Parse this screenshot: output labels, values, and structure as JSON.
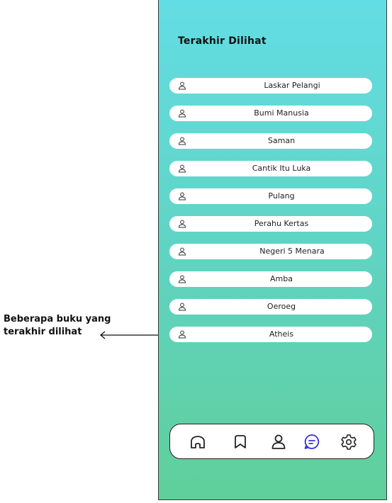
{
  "annotation": {
    "line1": "Beberapa buku yang",
    "line2": "terakhir dilihat"
  },
  "screen": {
    "title": "Terakhir Dilihat"
  },
  "recent_items": [
    {
      "label": "Laskar Pelangi",
      "icon": "user-icon"
    },
    {
      "label": "Bumi Manusia",
      "icon": "user-icon"
    },
    {
      "label": "Saman",
      "icon": "user-icon"
    },
    {
      "label": "Cantik Itu Luka",
      "icon": "user-icon"
    },
    {
      "label": "Pulang",
      "icon": "user-icon"
    },
    {
      "label": "Perahu Kertas",
      "icon": "user-icon"
    },
    {
      "label": "Negeri 5 Menara",
      "icon": "user-icon"
    },
    {
      "label": "Amba",
      "icon": "user-icon"
    },
    {
      "label": "Oeroeg",
      "icon": "user-icon"
    },
    {
      "label": "Atheis",
      "icon": "user-icon"
    }
  ],
  "bottom_nav": [
    {
      "icon": "home-icon",
      "active": false
    },
    {
      "icon": "bookmark-icon",
      "active": false
    },
    {
      "icon": "user-icon",
      "active": false
    },
    {
      "icon": "chat-icon",
      "active": true
    },
    {
      "icon": "settings-icon",
      "active": false
    }
  ],
  "colors": {
    "active": "#3b2fe0",
    "inactive": "#222222"
  }
}
